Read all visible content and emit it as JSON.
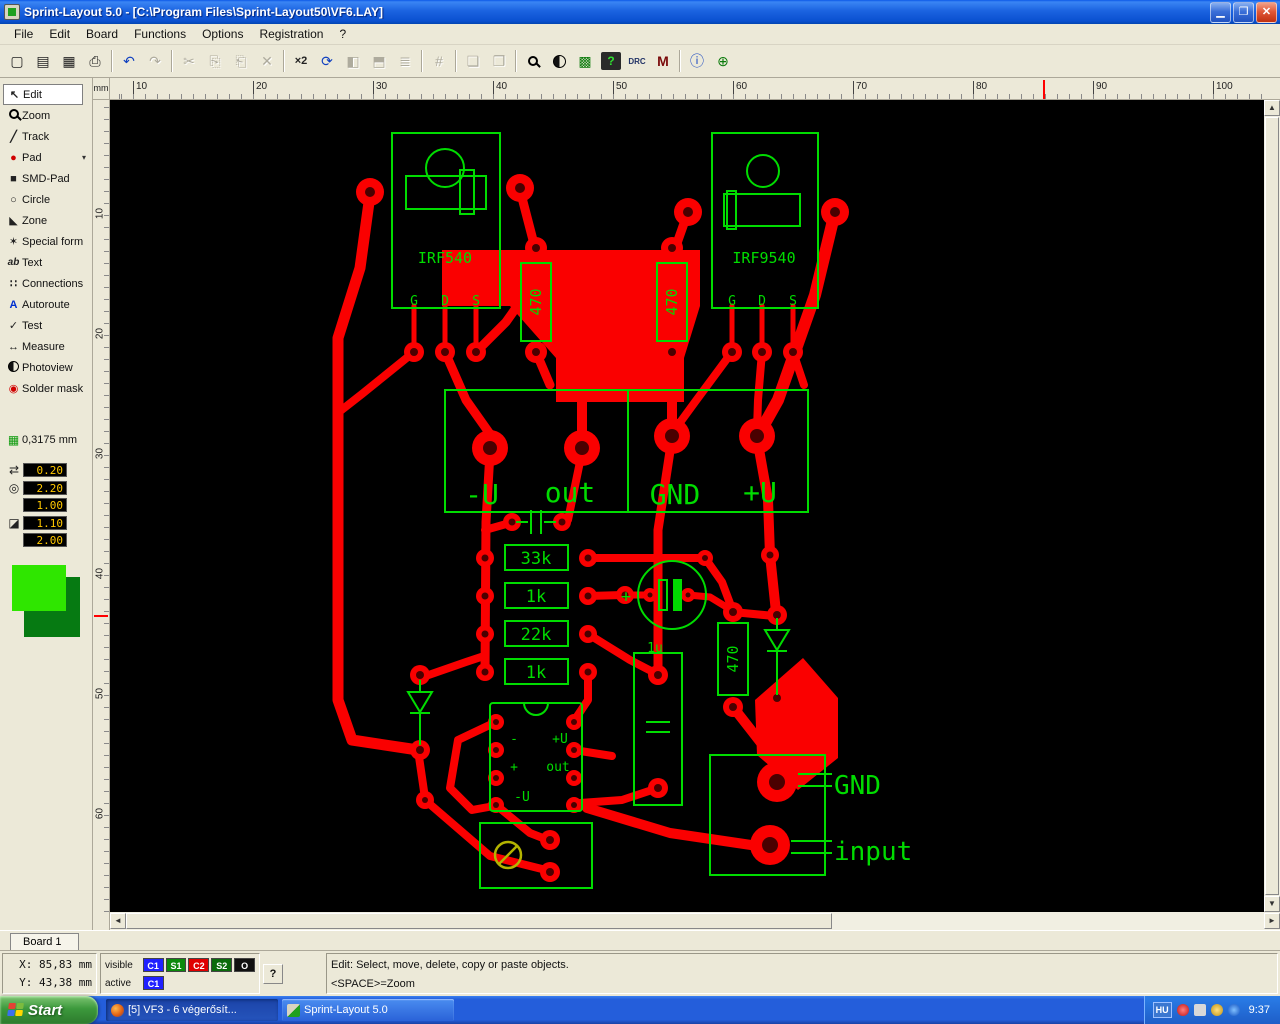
{
  "window": {
    "title": "Sprint-Layout 5.0 - [C:\\Program Files\\Sprint-Layout50\\VF6.LAY]",
    "minimize_glyph": "▁",
    "maximize_glyph": "❐",
    "close_glyph": "✕"
  },
  "menubar": {
    "items": [
      "File",
      "Edit",
      "Board",
      "Functions",
      "Options",
      "Registration",
      "?"
    ]
  },
  "toolbar": {
    "buttons": [
      {
        "name": "new",
        "glyph": "▢",
        "enabled": true
      },
      {
        "name": "open",
        "glyph": "▤",
        "enabled": true
      },
      {
        "name": "save",
        "glyph": "▦",
        "enabled": true
      },
      {
        "name": "print",
        "glyph": "⎙",
        "enabled": true
      },
      {
        "name": "undo",
        "glyph": "↶",
        "enabled": true
      },
      {
        "name": "redo",
        "glyph": "↷",
        "enabled": false
      },
      {
        "name": "cut",
        "glyph": "✂",
        "enabled": false
      },
      {
        "name": "copy",
        "glyph": "⎘",
        "enabled": false
      },
      {
        "name": "paste",
        "glyph": "⎗",
        "enabled": false
      },
      {
        "name": "delete",
        "glyph": "✕",
        "enabled": false
      },
      {
        "name": "scale-x2",
        "glyph": "×2",
        "enabled": true
      },
      {
        "name": "rotate",
        "glyph": "⟳",
        "enabled": true
      },
      {
        "name": "mirror-horizontal",
        "glyph": "◧",
        "enabled": false
      },
      {
        "name": "mirror-vertical",
        "glyph": "⬒",
        "enabled": false
      },
      {
        "name": "align",
        "glyph": "≣",
        "enabled": false
      },
      {
        "name": "ratsnest",
        "glyph": "#",
        "enabled": false
      },
      {
        "name": "group",
        "glyph": "❏",
        "enabled": false
      },
      {
        "name": "ungroup",
        "glyph": "❐",
        "enabled": false
      },
      {
        "name": "zoom",
        "glyph": "",
        "enabled": true
      },
      {
        "name": "photoview",
        "glyph": "",
        "enabled": true
      },
      {
        "name": "layer-grid",
        "glyph": "▩",
        "enabled": true
      },
      {
        "name": "test",
        "glyph": "?",
        "enabled": true
      },
      {
        "name": "drc",
        "glyph": "DRC",
        "enabled": true
      },
      {
        "name": "macros",
        "glyph": "M",
        "enabled": true
      },
      {
        "name": "info",
        "glyph": "ⓘ",
        "enabled": true
      },
      {
        "name": "origin",
        "glyph": "⊕",
        "enabled": true
      }
    ]
  },
  "sidebar": {
    "tools": [
      {
        "label": "Edit",
        "icon": "cursor",
        "glyph": "↖"
      },
      {
        "label": "Zoom",
        "icon": "magnifier",
        "glyph": ""
      },
      {
        "label": "Track",
        "icon": "track-line",
        "glyph": "╱"
      },
      {
        "label": "Pad",
        "icon": "pad",
        "glyph": "●",
        "extra": "▾"
      },
      {
        "label": "SMD-Pad",
        "icon": "smd-pad",
        "glyph": "■"
      },
      {
        "label": "Circle",
        "icon": "circle",
        "glyph": "○"
      },
      {
        "label": "Zone",
        "icon": "zone",
        "glyph": "◣"
      },
      {
        "label": "Special form",
        "icon": "special-form",
        "glyph": "✶"
      },
      {
        "label": "Text",
        "icon": "text",
        "glyph": "ab"
      },
      {
        "label": "Connections",
        "icon": "connections",
        "glyph": "∷"
      },
      {
        "label": "Autoroute",
        "icon": "autoroute",
        "glyph": "A"
      },
      {
        "label": "Test",
        "icon": "test-probe",
        "glyph": "✓"
      },
      {
        "label": "Measure",
        "icon": "measure",
        "glyph": "↔"
      },
      {
        "label": "Photoview",
        "icon": "photoview",
        "glyph": ""
      },
      {
        "label": "Solder mask",
        "icon": "solder-mask",
        "glyph": "◉"
      }
    ],
    "grid_icon": "▦",
    "grid_value": "0,3175 mm",
    "param_icons": {
      "track": "⇄",
      "pad": "◎",
      "smd": "◪"
    },
    "params": {
      "track_width": "0.20",
      "pad_diameter": "2.20",
      "pad_drill": "1.00",
      "smd_width": "1.10",
      "smd_height": "2.00"
    }
  },
  "rulers": {
    "unit": "mm",
    "h": [
      "10",
      "20",
      "30",
      "40",
      "50",
      "60",
      "70",
      "80",
      "90",
      "100"
    ],
    "v": [
      "10",
      "20",
      "30",
      "40",
      "50",
      "60"
    ]
  },
  "pcb": {
    "transistor1": "IRF540",
    "transistor2": "IRF9540",
    "pins1": [
      "G",
      "D",
      "S"
    ],
    "pins2": [
      "G",
      "D",
      "S"
    ],
    "r470a": "470",
    "r470b": "470",
    "r470c": "470",
    "term": {
      "minus_u": "-U",
      "out": "out",
      "gnd": "GND",
      "plus_u": "+U"
    },
    "res": [
      "33k",
      "1k",
      "22k",
      "1k"
    ],
    "cap_plus": "+",
    "cap_value": "1u",
    "ic": {
      "in_minus": "-",
      "plus_u": "+U",
      "in_plus": "+",
      "out": "out",
      "minus_u": "-U"
    },
    "conn": {
      "gnd": "GND",
      "input": "input"
    },
    "colors": {
      "copper": "#fa0000",
      "silkscreen": "#00dc00",
      "board_background": "#000000"
    }
  },
  "tabs": {
    "board": "Board 1"
  },
  "statusbar": {
    "x": "X:  85,83 mm",
    "y": "Y:  43,38 mm",
    "visible": "visible",
    "active": "active",
    "layers": [
      {
        "label": "C1",
        "color": "#2020ff"
      },
      {
        "label": "S1",
        "color": "#0b8a0b"
      },
      {
        "label": "C2",
        "color": "#e00000"
      },
      {
        "label": "S2",
        "color": "#0b6b0b"
      },
      {
        "label": "O",
        "color": "#101010"
      }
    ],
    "active_layer": {
      "label": "C1",
      "color": "#2020ff"
    },
    "help": "?",
    "hint1": "Edit: Select, move, delete, copy or paste objects.",
    "hint2": "<SPACE>=Zoom"
  },
  "taskbar": {
    "start": "Start",
    "tasks": [
      "[5] VF3 - 6 végerősít...",
      "Sprint-Layout 5.0"
    ],
    "language": "HU",
    "clock": "9:37"
  }
}
